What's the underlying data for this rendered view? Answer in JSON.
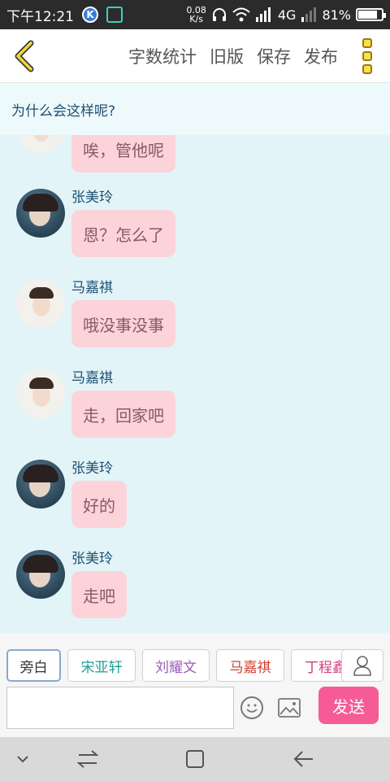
{
  "status_bar": {
    "time": "下午12:21",
    "net_speed_value": "0.08",
    "net_speed_unit": "K/s",
    "network": "4G",
    "battery": "81%",
    "battery_level": 0.81,
    "icons": [
      "k-app-icon",
      "scan-app-icon",
      "headphones-icon",
      "wifi-icon",
      "signal-icon",
      "battery-icon"
    ]
  },
  "top_bar": {
    "back_icon": "chevron-left-icon",
    "actions": [
      "字数统计",
      "旧版",
      "保存",
      "发布"
    ],
    "more_icon": "more-vertical-icon"
  },
  "subtitle": "为什么会这样呢?",
  "messages": [
    {
      "name": "",
      "text": "唉，管他呢",
      "avatar": "boy"
    },
    {
      "name": "张美玲",
      "text": "恩？怎么了",
      "avatar": "girl"
    },
    {
      "name": "马嘉祺",
      "text": "哦没事没事",
      "avatar": "boy"
    },
    {
      "name": "马嘉祺",
      "text": "走，回家吧",
      "avatar": "boy"
    },
    {
      "name": "张美玲",
      "text": "好的",
      "avatar": "girl"
    },
    {
      "name": "张美玲",
      "text": "走吧",
      "avatar": "girl"
    }
  ],
  "role_tabs": [
    {
      "label": "旁白",
      "color": "#333333",
      "active": true
    },
    {
      "label": "宋亚轩",
      "color": "#20a090",
      "active": false
    },
    {
      "label": "刘耀文",
      "color": "#9a5ab8",
      "active": false
    },
    {
      "label": "马嘉祺",
      "color": "#d04030",
      "active": false
    },
    {
      "label": "丁程鑫",
      "color": "#d04080",
      "active": false
    }
  ],
  "compose": {
    "input_value": "",
    "input_placeholder": "",
    "send_label": "发送",
    "send_color": "#f55c95",
    "icons": [
      "contact-icon",
      "emoji-icon",
      "image-icon"
    ]
  },
  "nav_bar": {
    "icons": [
      "chevron-down-icon",
      "menu-icon",
      "home-icon",
      "back-arrow-icon"
    ]
  }
}
